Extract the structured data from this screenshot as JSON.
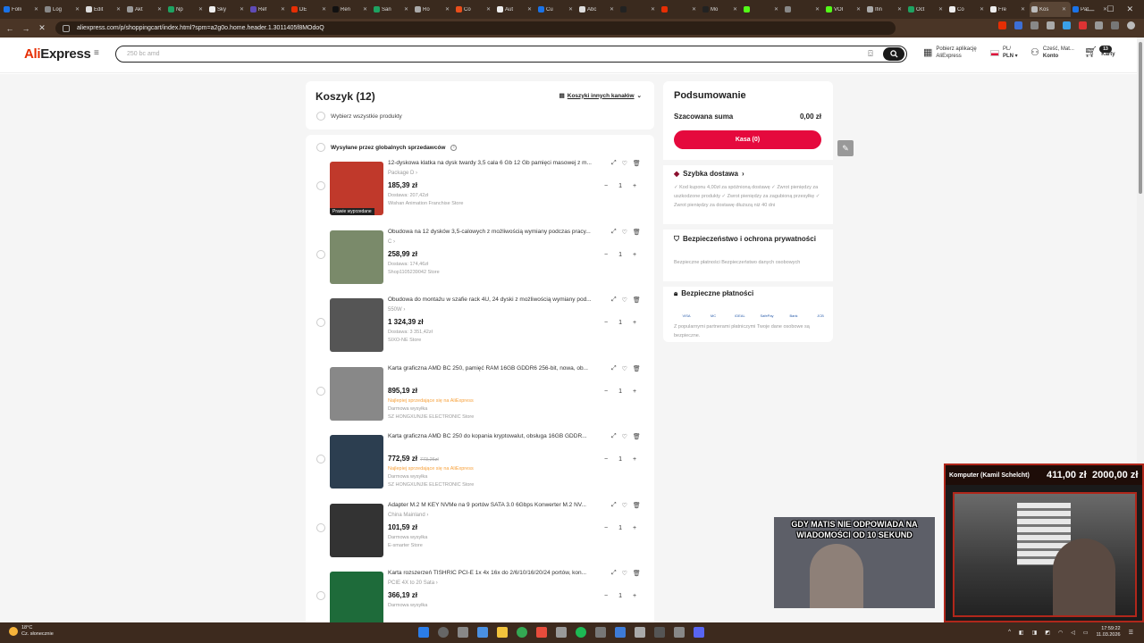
{
  "browser": {
    "tabs": [
      {
        "label": "Folli",
        "color": "#1a73e8"
      },
      {
        "label": "Log",
        "color": "#888888"
      },
      {
        "label": "Edit",
        "color": "#dddddd"
      },
      {
        "label": "Akt",
        "color": "#999999"
      },
      {
        "label": "Np",
        "color": "#1ea362"
      },
      {
        "label": "Sky",
        "color": "#eeeeee"
      },
      {
        "label": "Ref",
        "color": "#5f4bb6"
      },
      {
        "label": "DE",
        "color": "#e62e04"
      },
      {
        "label": "Ren",
        "color": "#111111"
      },
      {
        "label": "San",
        "color": "#1ea362"
      },
      {
        "label": "Ro",
        "color": "#aaaaaa"
      },
      {
        "label": "Co",
        "color": "#e94e1b"
      },
      {
        "label": "Aut",
        "color": "#eeeeee"
      },
      {
        "label": "Cu",
        "color": "#1a73e8"
      },
      {
        "label": "Abc",
        "color": "#dddddd"
      },
      {
        "label": "",
        "color": "#222222"
      },
      {
        "label": "",
        "color": "#e62e04"
      },
      {
        "label": "Mo",
        "color": "#222222"
      },
      {
        "label": "",
        "color": "#53fc18"
      },
      {
        "label": "",
        "color": "#888888"
      },
      {
        "label": "VOI",
        "color": "#53fc18"
      },
      {
        "label": "Ifin",
        "color": "#aaaaaa"
      },
      {
        "label": "Oct",
        "color": "#1ea362"
      },
      {
        "label": "Co",
        "color": "#eeeeee"
      },
      {
        "label": "Fre",
        "color": "#eeeeee"
      },
      {
        "label": "Kos",
        "color": "#bbbbbb"
      },
      {
        "label": "Pat",
        "color": "#1a73e8"
      }
    ],
    "active_tab_index": 25,
    "url": "aliexpress.com/p/shoppingcart/index.html?spm=a2g0o.home.header.1.3011405f8MOdoQ"
  },
  "header": {
    "logo_a": "Ali",
    "logo_b": "Express",
    "search_placeholder": "250 bc amd",
    "app_line1": "Pobierz aplikację",
    "app_line2": "AliExpress",
    "lang_line1": "PL/",
    "lang_line2": "PLN",
    "account_line1": "Cześć, Mat...",
    "account_line2": "Konto",
    "cart_count": "13",
    "cart_label": "Karty"
  },
  "cart": {
    "title": "Koszyk (12)",
    "other_carts": "Koszyki innych kanałów",
    "select_all": "Wybierz wszystkie produkty",
    "seller_group": "Wysyłane przez globalnych sprzedawców",
    "items": [
      {
        "title": "12-dyskowa klatka na dysk twardy 3,5 cala 6 Gb 12 Gb pamięci masowej z m...",
        "variant": "Package D",
        "price": "185,39 zł",
        "old_price": "",
        "l1": "Dostawa: 207,42zł",
        "l1_promo": false,
        "l2": "Wishan Animation Franchise Store",
        "l3": "",
        "tag": "Prawie wyprzedane",
        "qty": "1",
        "img_color": "#c0392b"
      },
      {
        "title": "Obudowa na 12 dysków 3,5-calowych z możliwością wymiany podczas pracy...",
        "variant": "C",
        "price": "258,99 zł",
        "old_price": "",
        "l1": "Dostawa: 174,46zł",
        "l1_promo": false,
        "l2": "Shop1105239042 Store",
        "l3": "",
        "tag": "",
        "qty": "1",
        "img_color": "#7a8a6a"
      },
      {
        "title": "Obudowa do montażu w szafie rack 4U, 24 dyski z możliwością wymiany pod...",
        "variant": "550W",
        "price": "1 324,39 zł",
        "old_price": "",
        "l1": "Dostawa: 3 351,42zł",
        "l1_promo": false,
        "l2": "SIXO-NE Store",
        "l3": "",
        "tag": "",
        "qty": "1",
        "img_color": "#555555"
      },
      {
        "title": "Karta graficzna AMD BC 250, pamięć RAM 16GB GDDR6 256-bit, nowa, ob...",
        "variant": "",
        "price": "895,19 zł",
        "old_price": "",
        "l1": "Najlepiej sprzedające się na AliExpress",
        "l1_promo": true,
        "l2": "Darmowa wysyłka",
        "l3": "SZ HONGXUNJIE ELECTRONIC Store",
        "tag": "",
        "qty": "1",
        "img_color": "#888888"
      },
      {
        "title": "Karta graficzna AMD BC 250 do kopania kryptowalut, obsługa 16GB GDDR...",
        "variant": "",
        "price": "772,59 zł",
        "old_price": "773,26zł",
        "l1": "Najlepiej sprzedające się na AliExpress",
        "l1_promo": true,
        "l2": "Darmowa wysyłka",
        "l3": "SZ HONGXUNJIE ELECTRONIC Store",
        "tag": "",
        "qty": "1",
        "img_color": "#2c3e50"
      },
      {
        "title": "Adapter M.2 M KEY NVMe na 9 portów SATA 3.0 6Gbps Konwerter M.2 NV...",
        "variant": "China Mainland",
        "price": "101,59 zł",
        "old_price": "",
        "l1": "Darmowa wysyłka",
        "l1_promo": false,
        "l2": "E-smarter Store",
        "l3": "",
        "tag": "",
        "qty": "1",
        "img_color": "#333333"
      },
      {
        "title": "Karta rozszerzeń TISHRIC PCI-E 1x 4x 16x do 2/6/10/16/20/24 portów, kon...",
        "variant": "PCIE 4X to 20 Sata",
        "price": "366,19 zł",
        "old_price": "",
        "l1": "Darmowa wysyłka",
        "l1_promo": false,
        "l2": "",
        "l3": "",
        "tag": "",
        "qty": "1",
        "img_color": "#1e6b3a"
      }
    ]
  },
  "summary": {
    "title": "Podsumowanie",
    "estimated_label": "Szacowana suma",
    "estimated_value": "0,00 zł",
    "checkout": "Kasa (0)",
    "delivery_title": "Szybka dostawa",
    "delivery_text": "✓ Kod kuponu 4,00zł za spóźnioną dostawę ✓ Zwrot pieniędzy za uszkodzone produkty ✓ Zwrot pieniędzy za zagubioną przesyłkę ✓ Zwrot pieniędzy za dostawę dłuższą niż 40 dni",
    "security_title": "Bezpieczeństwo i ochrona prywatności",
    "security_text": "Bezpieczne płatności Bezpieczeństwo danych osobowych",
    "payments_title": "Bezpieczne płatności",
    "payments_text": "Z popularnymi partnerami płatniczymi Twoje dane osobowe są bezpieczne.",
    "pay_logos": [
      "VISA",
      "MC",
      "iDEAL",
      "SafePay",
      "Bank",
      "JCB"
    ]
  },
  "stream": {
    "meme_text": "GDY MATIS NIE ODPOWIADA NA WIADOMOŚCI OD 10 SEKUND",
    "goal_label": "Komputer (Kamil Schelcht)",
    "goal_current": "411,00 zł",
    "goal_target": "2000,00 zł"
  },
  "taskbar": {
    "temp": "18°C",
    "weather": "Cz. słonecznie",
    "time": "17:59:22",
    "date": "11.03.2026"
  }
}
